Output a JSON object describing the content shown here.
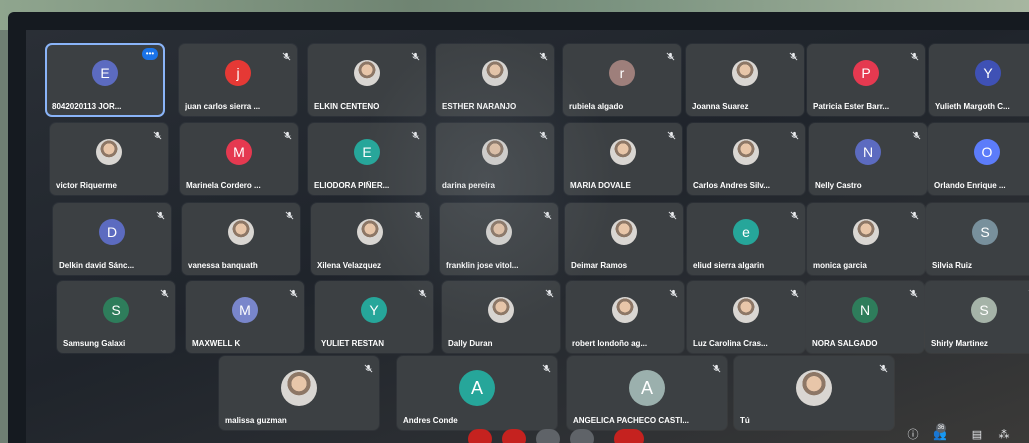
{
  "meeting": {
    "participants": [
      {
        "name": "8042020113 JOR...",
        "initial": "E",
        "color": "#5c6bc0",
        "speaking": true
      },
      {
        "name": "juan carlos sierra ...",
        "initial": "j",
        "color": "#e53935"
      },
      {
        "name": "ELKIN CENTENO",
        "photo": true
      },
      {
        "name": "ESTHER NARANJO",
        "photo": true
      },
      {
        "name": "rubiela algado",
        "initial": "r",
        "color": "#9e7f7b"
      },
      {
        "name": "Joanna Suarez",
        "photo": true
      },
      {
        "name": "Patricia Ester Barr...",
        "initial": "P",
        "color": "#e53950"
      },
      {
        "name": "Yulieth Margoth C...",
        "initial": "Y",
        "color": "#3f51b5"
      },
      {
        "name": "victor Riquerme",
        "photo": true
      },
      {
        "name": "Marinela Cordero ...",
        "initial": "M",
        "color": "#e53950"
      },
      {
        "name": "ELIODORA PIÑER...",
        "initial": "E",
        "color": "#26a69a"
      },
      {
        "name": "darina pereira",
        "photo": true
      },
      {
        "name": "MARIA DOVALE",
        "photo": true
      },
      {
        "name": "Carlos Andres Silv...",
        "photo": true
      },
      {
        "name": "Nelly Castro",
        "initial": "N",
        "color": "#5c6bc0"
      },
      {
        "name": "Orlando Enrique ...",
        "initial": "O",
        "color": "#5c7cfa"
      },
      {
        "name": "Delkin david Sánc...",
        "initial": "D",
        "color": "#5c6bc0"
      },
      {
        "name": "vanessa banquath",
        "photo": true
      },
      {
        "name": "Xilena Velazquez",
        "photo": true
      },
      {
        "name": "franklin jose vitol...",
        "photo": true
      },
      {
        "name": "Deimar Ramos",
        "photo": true
      },
      {
        "name": "eliud sierra algarin",
        "initial": "e",
        "color": "#26a69a"
      },
      {
        "name": "monica garcia",
        "photo": true
      },
      {
        "name": "Silvia Ruiz",
        "initial": "S",
        "color": "#78909c"
      },
      {
        "name": "Samsung Galaxi",
        "initial": "S",
        "color": "#2e7d5b"
      },
      {
        "name": "MAXWELL K",
        "initial": "M",
        "color": "#7986cb"
      },
      {
        "name": "YULIET RESTAN",
        "initial": "Y",
        "color": "#26a69a"
      },
      {
        "name": "Dally Duran",
        "photo": true
      },
      {
        "name": "robert londoño ag...",
        "photo": true
      },
      {
        "name": "Luz Carolina Cras...",
        "photo": true
      },
      {
        "name": "NORA SALGADO",
        "initial": "N",
        "color": "#2e7d5b"
      },
      {
        "name": "Shirly Martinez",
        "initial": "S",
        "color": "#a5b3a8"
      },
      {
        "name": "malissa guzman",
        "photo": true
      },
      {
        "name": "Andres Conde",
        "initial": "A",
        "color": "#26a69a"
      },
      {
        "name": "ANGELICA PACHECO CASTI...",
        "initial": "A",
        "color": "#9bb0ad"
      },
      {
        "name": "Tú",
        "photo": true
      }
    ]
  },
  "toolbar": {
    "info_icon": "info-icon",
    "people_icon": "people-icon",
    "people_count": "36",
    "chat_icon": "chat-icon",
    "activities_icon": "activities-icon"
  }
}
